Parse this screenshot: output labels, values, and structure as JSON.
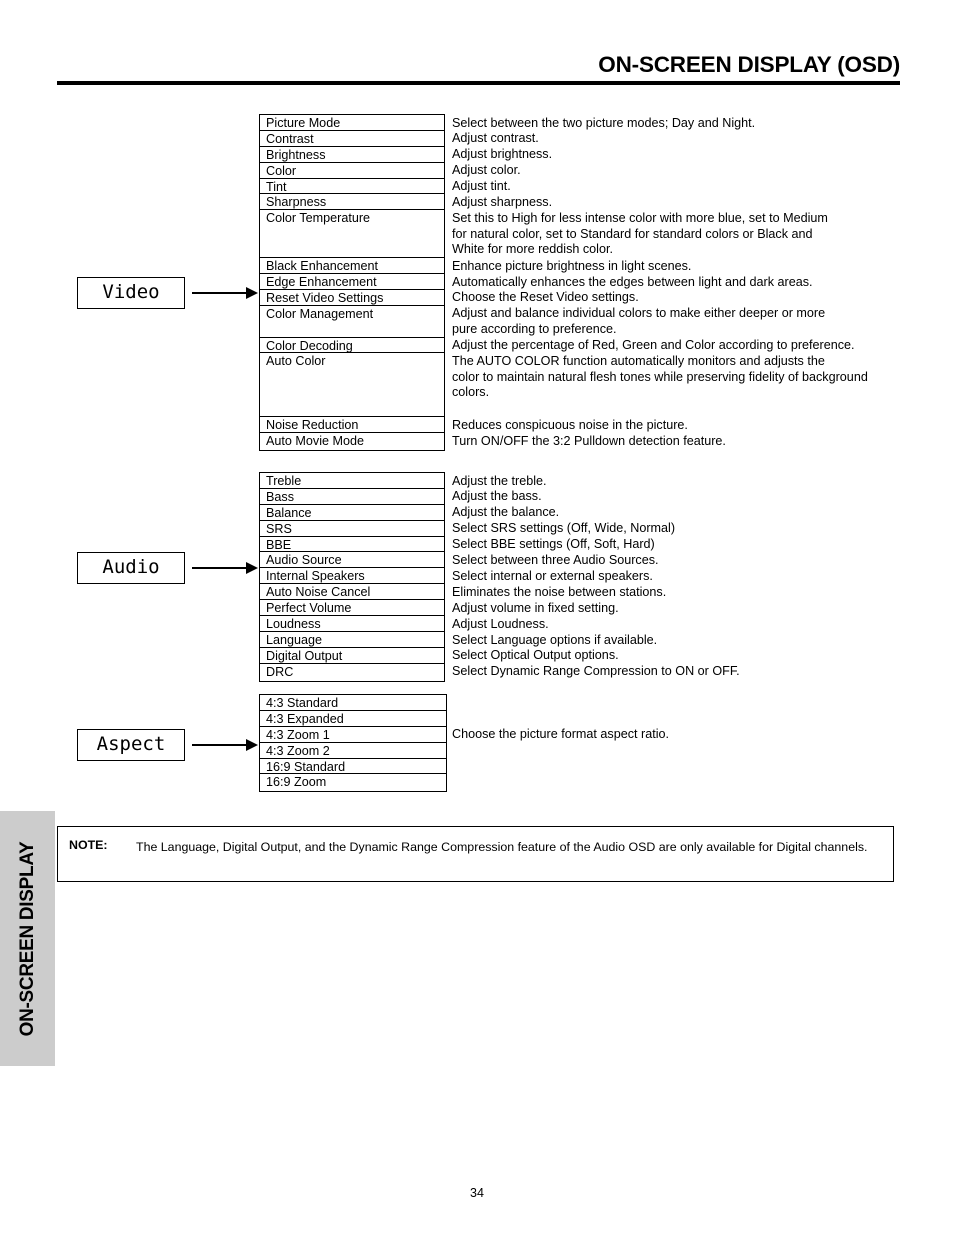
{
  "header": {
    "title": "ON-SCREEN DISPLAY (OSD)"
  },
  "side_tab": {
    "label": "ON-SCREEN DISPLAY"
  },
  "groups": [
    {
      "key": "video",
      "label": "Video",
      "items": [
        "Picture Mode",
        "Contrast",
        "Brightness",
        "Color",
        "Tint",
        "Sharpness",
        "Color Temperature",
        "Black Enhancement",
        "Edge Enhancement",
        "Reset Video Settings",
        "Color Management",
        "Color Decoding",
        "Auto Color",
        "Noise Reduction",
        "Auto Movie Mode"
      ],
      "descriptions": [
        [
          "Select between the two picture modes; Day and Night."
        ],
        [
          "Adjust contrast."
        ],
        [
          "Adjust brightness."
        ],
        [
          "Adjust color."
        ],
        [
          "Adjust tint."
        ],
        [
          "Adjust sharpness."
        ],
        [
          "Set this to High for less intense color with more blue, set to Medium",
          "for natural color, set to Standard for standard colors or Black and",
          "White for more reddish color."
        ],
        [
          "Enhance picture brightness in light scenes."
        ],
        [
          "Automatically enhances the edges between light and dark areas."
        ],
        [
          "Choose the Reset Video settings."
        ],
        [
          "Adjust and balance individual colors to make either deeper or more",
          "pure according to preference."
        ],
        [
          "Adjust the percentage of Red, Green and Color according to preference."
        ],
        [
          "The AUTO COLOR function automatically monitors and adjusts the",
          "color to maintain natural flesh tones while preserving fidelity of background",
          "colors."
        ],
        [
          "Reduces conspicuous noise in the picture."
        ],
        [
          "Turn ON/OFF the 3:2 Pulldown detection feature."
        ]
      ]
    },
    {
      "key": "audio",
      "label": "Audio",
      "items": [
        "Treble",
        "Bass",
        "Balance",
        "SRS",
        "BBE",
        "Audio Source",
        "Internal Speakers",
        "Auto Noise Cancel",
        "Perfect Volume",
        "Loudness",
        "Language",
        "Digital Output",
        "DRC"
      ],
      "descriptions": [
        [
          "Adjust the treble."
        ],
        [
          "Adjust the bass."
        ],
        [
          "Adjust the balance."
        ],
        [
          "Select SRS settings (Off, Wide, Normal)"
        ],
        [
          "Select BBE settings (Off, Soft, Hard)"
        ],
        [
          "Select between three Audio Sources."
        ],
        [
          "Select internal or external speakers."
        ],
        [
          "Eliminates the noise between stations."
        ],
        [
          "Adjust volume in fixed setting."
        ],
        [
          "Adjust Loudness."
        ],
        [
          "Select Language options if available."
        ],
        [
          "Select Optical Output options."
        ],
        [
          "Select Dynamic Range Compression to ON or OFF."
        ]
      ]
    },
    {
      "key": "aspect",
      "label": "Aspect",
      "items": [
        "4:3 Standard",
        "4:3 Expanded",
        "4:3 Zoom 1",
        "4:3 Zoom 2",
        "16:9 Standard",
        "16:9 Zoom"
      ],
      "descriptions": [
        [],
        [],
        [
          "Choose the picture format aspect ratio."
        ],
        [],
        [],
        []
      ]
    }
  ],
  "note": {
    "label": "NOTE:",
    "text": "The Language, Digital Output, and the Dynamic Range Compression feature of the Audio OSD are only available for Digital channels."
  },
  "footer": {
    "page_number": "34"
  }
}
